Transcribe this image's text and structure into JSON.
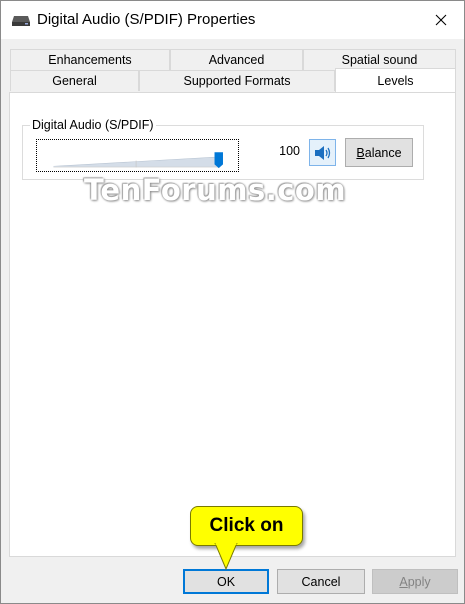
{
  "window": {
    "title": "Digital Audio (S/PDIF) Properties",
    "close_label": "×"
  },
  "tabs": {
    "row_top": [
      {
        "label": "Enhancements"
      },
      {
        "label": "Advanced"
      },
      {
        "label": "Spatial sound"
      }
    ],
    "row_bottom": [
      {
        "label": "General"
      },
      {
        "label": "Supported Formats"
      },
      {
        "label": "Levels",
        "active": true
      }
    ]
  },
  "levels": {
    "group_label": "Digital Audio (S/PDIF)",
    "value_text": "100",
    "level_fraction": 1.0,
    "balance_label_mnemonic": "B",
    "balance_label_rest": "alance"
  },
  "watermark": {
    "text": "TenForums.com"
  },
  "callout": {
    "text": "Click on",
    "color": "#ffff00"
  },
  "buttons": {
    "ok": "OK",
    "cancel": "Cancel",
    "apply_mnemonic": "A",
    "apply_rest": "pply"
  },
  "colors": {
    "accent": "#0078d7",
    "slider_fill": "#0078d7"
  },
  "icons": {
    "title": "speaker-device-icon",
    "speaker": "speaker-volume-icon",
    "close": "close-icon",
    "pointer": "callout-arrow-icon"
  }
}
